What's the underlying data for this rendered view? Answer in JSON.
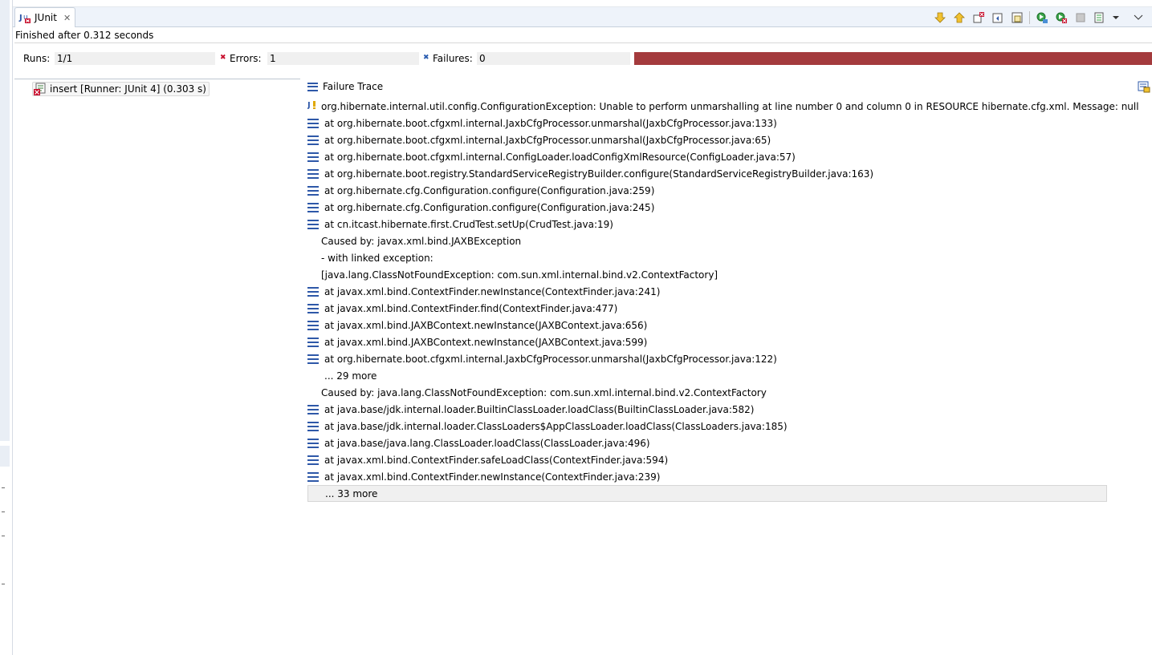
{
  "view": {
    "tab_label": "JUnit",
    "status_text": "Finished after 0.312 seconds"
  },
  "counters": {
    "runs_label": "Runs:",
    "runs_value": "1/1",
    "errors_label": "Errors:",
    "errors_value": "1",
    "failures_label": "Failures:",
    "failures_value": "0",
    "progress_fraction": 1.0,
    "progress_color": "#a43b3d"
  },
  "tree": {
    "item_label": "insert [Runner: JUnit 4] (0.303 s)"
  },
  "trace": {
    "header": "Failure Trace",
    "exception": "org.hibernate.internal.util.config.ConfigurationException: Unable to perform unmarshalling at line number 0 and column 0 in RESOURCE hibernate.cfg.xml. Message: null",
    "lines": [
      {
        "kind": "frame",
        "text": "at org.hibernate.boot.cfgxml.internal.JaxbCfgProcessor.unmarshal(JaxbCfgProcessor.java:133)"
      },
      {
        "kind": "frame",
        "text": "at org.hibernate.boot.cfgxml.internal.JaxbCfgProcessor.unmarshal(JaxbCfgProcessor.java:65)"
      },
      {
        "kind": "frame",
        "text": "at org.hibernate.boot.cfgxml.internal.ConfigLoader.loadConfigXmlResource(ConfigLoader.java:57)"
      },
      {
        "kind": "frame",
        "text": "at org.hibernate.boot.registry.StandardServiceRegistryBuilder.configure(StandardServiceRegistryBuilder.java:163)"
      },
      {
        "kind": "frame",
        "text": "at org.hibernate.cfg.Configuration.configure(Configuration.java:259)"
      },
      {
        "kind": "frame",
        "text": "at org.hibernate.cfg.Configuration.configure(Configuration.java:245)"
      },
      {
        "kind": "frame",
        "text": "at cn.itcast.hibernate.first.CrudTest.setUp(CrudTest.java:19)"
      },
      {
        "kind": "plain",
        "text": "Caused by: javax.xml.bind.JAXBException"
      },
      {
        "kind": "plain",
        "text": " - with linked exception:"
      },
      {
        "kind": "plain",
        "text": "[java.lang.ClassNotFoundException: com.sun.xml.internal.bind.v2.ContextFactory]"
      },
      {
        "kind": "frame",
        "text": "at javax.xml.bind.ContextFinder.newInstance(ContextFinder.java:241)"
      },
      {
        "kind": "frame",
        "text": "at javax.xml.bind.ContextFinder.find(ContextFinder.java:477)"
      },
      {
        "kind": "frame",
        "text": "at javax.xml.bind.JAXBContext.newInstance(JAXBContext.java:656)"
      },
      {
        "kind": "frame",
        "text": "at javax.xml.bind.JAXBContext.newInstance(JAXBContext.java:599)"
      },
      {
        "kind": "frame",
        "text": "at org.hibernate.boot.cfgxml.internal.JaxbCfgProcessor.unmarshal(JaxbCfgProcessor.java:122)"
      },
      {
        "kind": "more",
        "text": "... 29 more"
      },
      {
        "kind": "plain",
        "text": "Caused by: java.lang.ClassNotFoundException: com.sun.xml.internal.bind.v2.ContextFactory"
      },
      {
        "kind": "frame",
        "text": "at java.base/jdk.internal.loader.BuiltinClassLoader.loadClass(BuiltinClassLoader.java:582)"
      },
      {
        "kind": "frame",
        "text": "at java.base/jdk.internal.loader.ClassLoaders$AppClassLoader.loadClass(ClassLoaders.java:185)"
      },
      {
        "kind": "frame",
        "text": "at java.base/java.lang.ClassLoader.loadClass(ClassLoader.java:496)"
      },
      {
        "kind": "frame",
        "text": "at javax.xml.bind.ContextFinder.safeLoadClass(ContextFinder.java:594)"
      },
      {
        "kind": "frame",
        "text": "at javax.xml.bind.ContextFinder.newInstance(ContextFinder.java:239)"
      },
      {
        "kind": "more",
        "text": "... 33 more",
        "selected": true
      }
    ]
  },
  "toolbar_icons": [
    "next-failure-icon",
    "previous-failure-icon",
    "show-failures-only-icon",
    "scroll-lock-icon",
    "show-skipped-icon",
    "rerun-test-icon",
    "rerun-failed-first-icon",
    "stop-icon",
    "test-run-history-icon",
    "view-menu-icon",
    "minimize-icon"
  ],
  "colors": {
    "accent": "#2e58a8",
    "error_bar": "#a43b3d",
    "tab_bar": "#eef3fa"
  }
}
